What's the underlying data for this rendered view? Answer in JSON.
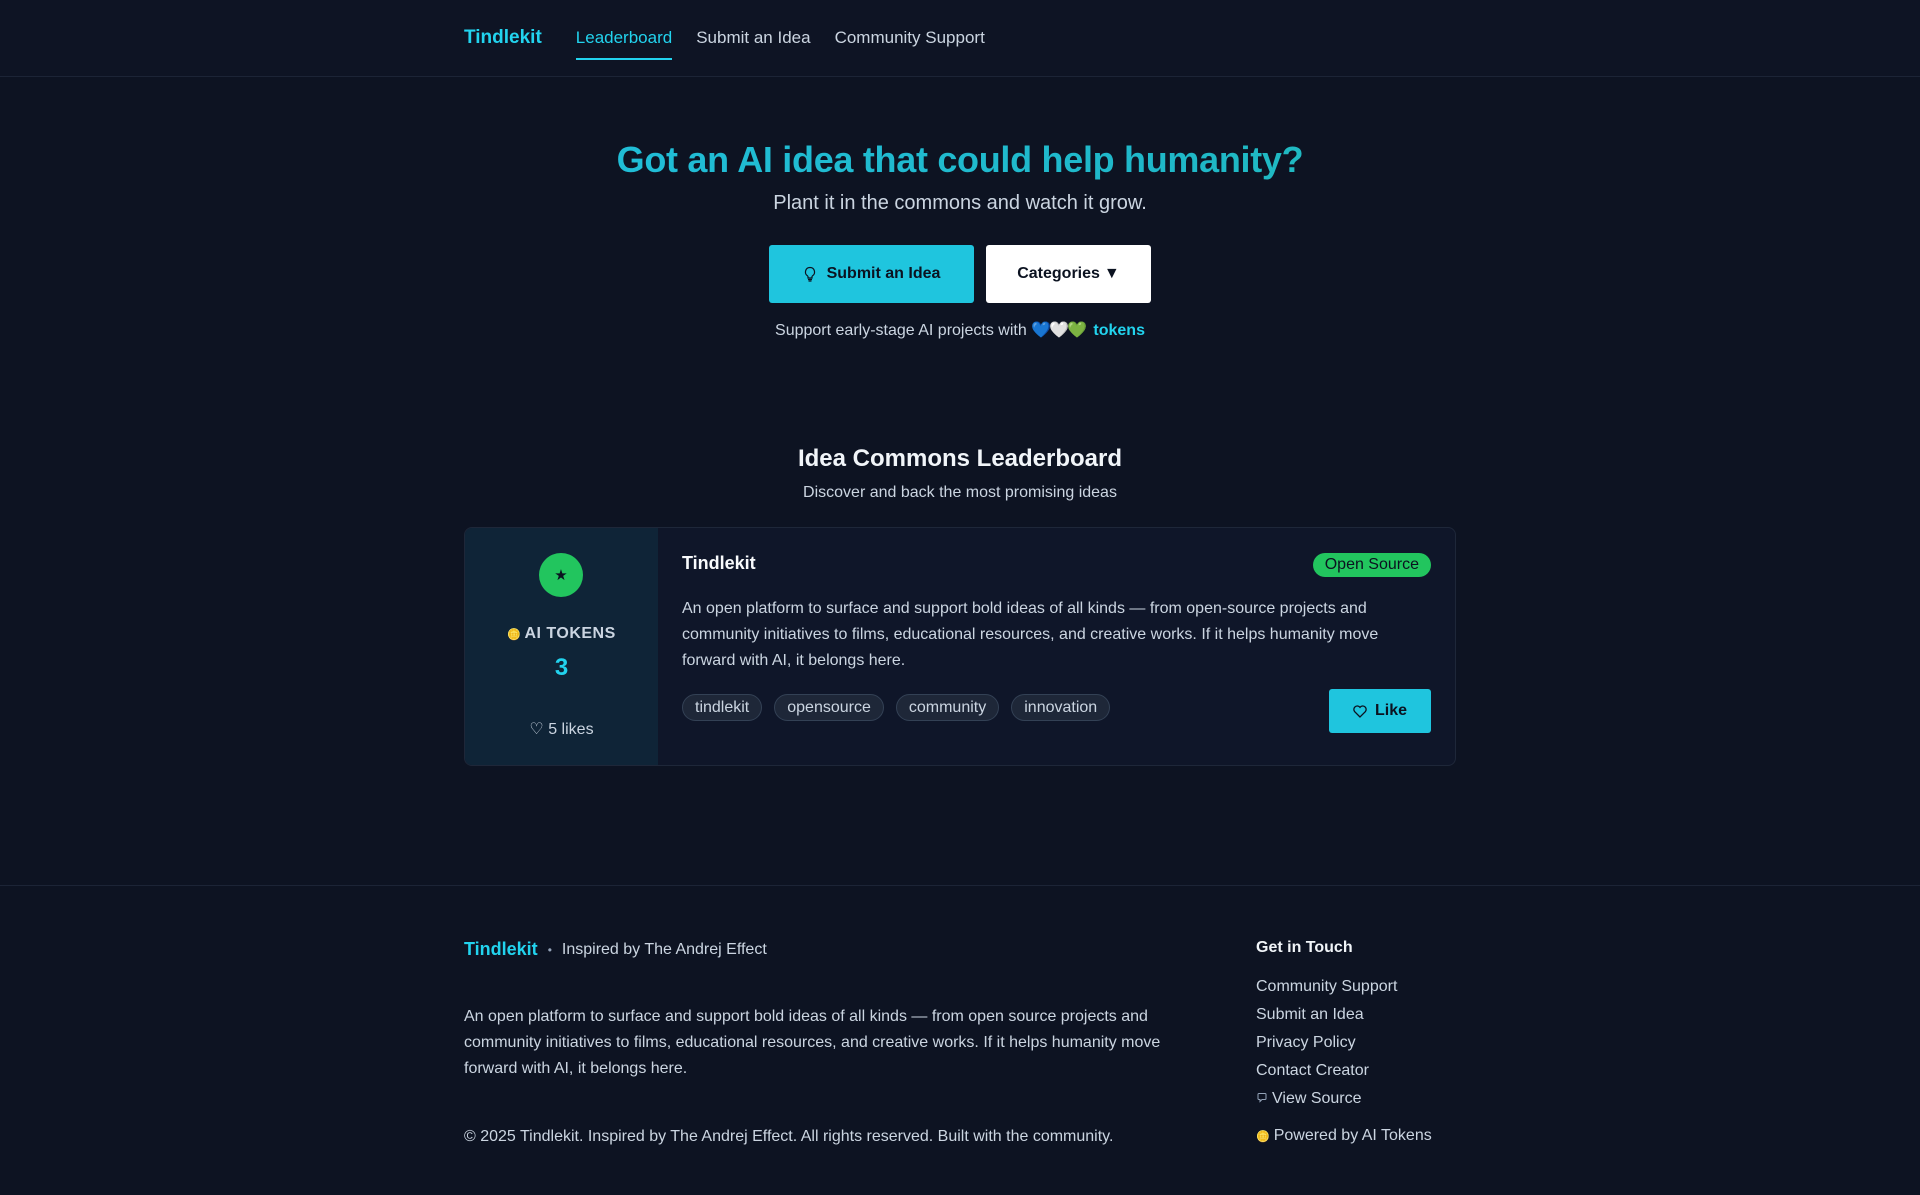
{
  "nav": {
    "brand": "Tindlekit",
    "links": [
      "Leaderboard",
      "Submit an Idea",
      "Community Support"
    ]
  },
  "hero": {
    "title": "Got an AI idea that could help humanity?",
    "subtitle": "Plant it in the commons and watch it grow.",
    "submit_label": "Submit an Idea",
    "categories_label": "Categories",
    "categories_caret": "▼",
    "support_text": "Support early-stage AI projects with",
    "hearts": "💙🤍💚",
    "tokens_link": "tokens"
  },
  "leaderboard": {
    "title": "Idea Commons Leaderboard",
    "subtitle": "Discover and back the most promising ideas"
  },
  "idea": {
    "rank_icon": "★",
    "tokens_label": "AI TOKENS",
    "tokens_value": "3",
    "likes": "♡ 5 likes",
    "title": "Tindlekit",
    "badge": "Open Source",
    "description": "An open platform to surface and support bold ideas of all kinds — from open-source projects and community initiatives to films, educational resources, and creative works. If it helps humanity move forward with AI, it belongs here.",
    "tags": [
      "tindlekit",
      "opensource",
      "community",
      "innovation"
    ],
    "like_label": "Like"
  },
  "footer": {
    "brand": "Tindlekit",
    "inspired": "Inspired by The Andrej Effect",
    "description": "An open platform to surface and support bold ideas of all kinds — from open source projects and community initiatives to films, educational resources, and creative works. If it helps humanity move forward with AI, it belongs here.",
    "copyright": "© 2025 Tindlekit. Inspired by The Andrej Effect. All rights reserved. Built with the community.",
    "contact_title": "Get in Touch",
    "links": [
      "Community Support",
      "Submit an Idea",
      "Privacy Policy",
      "Contact Creator"
    ],
    "view_source": "View Source",
    "powered": "Powered by AI Tokens"
  },
  "colors": {
    "accent": "#22d3ee",
    "success": "#22c55e",
    "background": "#0d1322"
  }
}
